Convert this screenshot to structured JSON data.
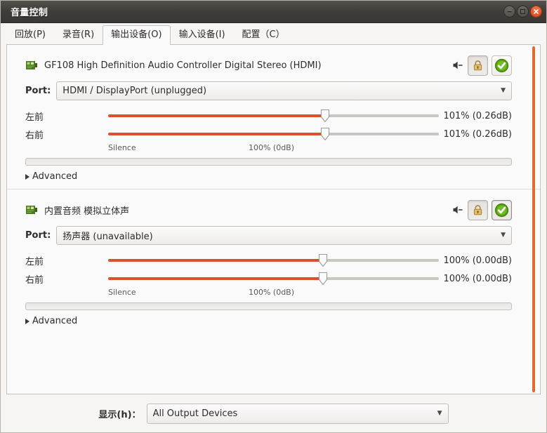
{
  "window": {
    "title": "音量控制",
    "controls": [
      {
        "name": "minimize",
        "glyph": "minimize-icon"
      },
      {
        "name": "maximize",
        "glyph": "maximize-icon"
      },
      {
        "name": "close",
        "glyph": "close-icon"
      }
    ]
  },
  "tabs": [
    {
      "label": "回放(P)",
      "active": false
    },
    {
      "label": "录音(R)",
      "active": false
    },
    {
      "label": "输出设备(O)",
      "active": true
    },
    {
      "label": "输入设备(I)",
      "active": false
    },
    {
      "label": "配置（C）",
      "active": false
    }
  ],
  "devices": [
    {
      "icon": "sound-card-icon",
      "name": "GF108 High Definition Audio Controller Digital Stereo (HDMI)",
      "mute_icon": "speaker-muted-icon",
      "lock_icon": "padlock-icon",
      "default_icon": "green-check-icon",
      "default_active": false,
      "port_label": "Port:",
      "port_value": "HDMI / DisplayPort (unplugged)",
      "channels": [
        {
          "label": "左前",
          "value": "101% (0.26dB)",
          "percent": 101
        },
        {
          "label": "右前",
          "value": "101% (0.26dB)",
          "percent": 101
        }
      ],
      "scale_left": "Silence",
      "scale_mid": "100% (0dB)",
      "advanced_label": "Advanced"
    },
    {
      "icon": "sound-card-icon",
      "name": "内置音频 模拟立体声",
      "mute_icon": "speaker-muted-icon",
      "lock_icon": "padlock-icon",
      "default_icon": "green-check-icon",
      "default_active": true,
      "port_label": "Port:",
      "port_value": "扬声器 (unavailable)",
      "channels": [
        {
          "label": "左前",
          "value": "100% (0.00dB)",
          "percent": 100
        },
        {
          "label": "右前",
          "value": "100% (0.00dB)",
          "percent": 100
        }
      ],
      "scale_left": "Silence",
      "scale_mid": "100% (0dB)",
      "advanced_label": "Advanced"
    }
  ],
  "bottom": {
    "show_label": "显示(h)：",
    "show_value": "All Output Devices",
    "arrow_icon": "chevron-down-icon"
  },
  "colors": {
    "slider_fill": "#d9522a",
    "scrollbar": "#e2692f",
    "close_button": "#e2542a",
    "check_green": "#4e9a06",
    "titlebar": "#3f3c3a"
  }
}
